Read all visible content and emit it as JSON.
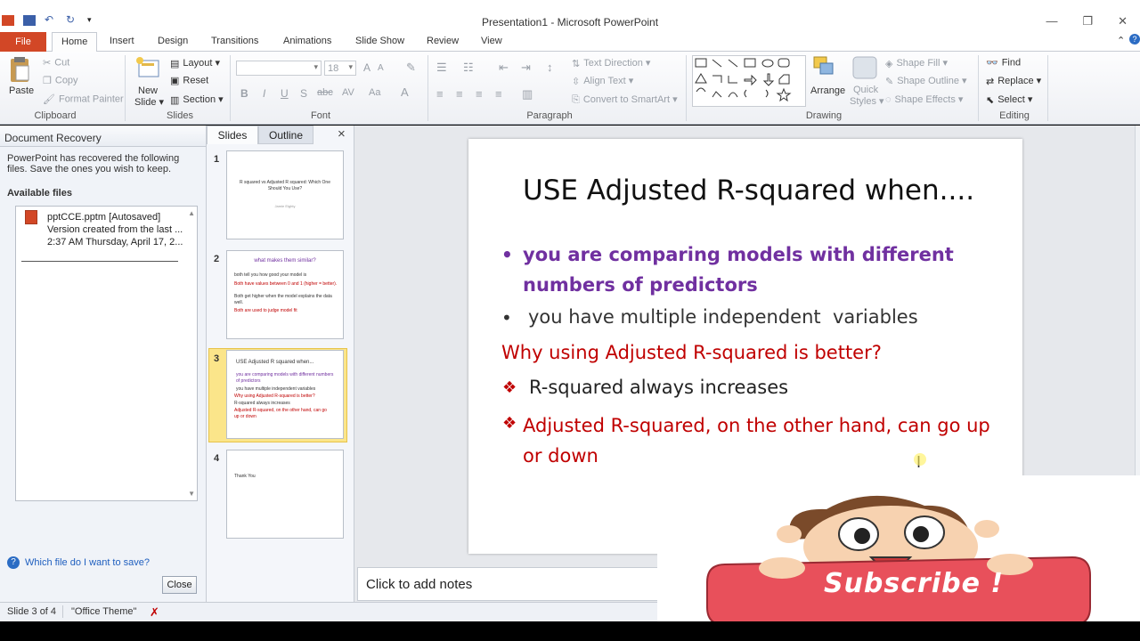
{
  "window": {
    "title": "Presentation1 - Microsoft PowerPoint"
  },
  "tabs": {
    "file": "File",
    "items": [
      "Home",
      "Insert",
      "Design",
      "Transitions",
      "Animations",
      "Slide Show",
      "Review",
      "View"
    ]
  },
  "ribbon": {
    "clipboard": {
      "paste": "Paste",
      "cut": "Cut",
      "copy": "Copy",
      "format_painter": "Format Painter",
      "label": "Clipboard"
    },
    "slides": {
      "new_slide": "New",
      "new_slide2": "Slide",
      "layout": "Layout",
      "reset": "Reset",
      "section": "Section",
      "label": "Slides"
    },
    "font": {
      "size": "18",
      "label": "Font"
    },
    "paragraph": {
      "text_direction": "Text Direction",
      "align_text": "Align Text",
      "convert": "Convert to SmartArt",
      "label": "Paragraph"
    },
    "drawing": {
      "arrange": "Arrange",
      "quick_styles": "Quick",
      "quick_styles2": "Styles",
      "shape_fill": "Shape Fill",
      "shape_outline": "Shape Outline",
      "shape_effects": "Shape Effects",
      "label": "Drawing"
    },
    "editing": {
      "find": "Find",
      "replace": "Replace",
      "select": "Select",
      "label": "Editing"
    }
  },
  "recovery": {
    "header": "Document Recovery",
    "message": "PowerPoint has recovered the following files. Save the ones you wish to keep.",
    "available": "Available files",
    "file_name": "pptCCE.pptm  [Autosaved]",
    "file_line2": "Version created from the last ...",
    "file_line3": "2:37 AM Thursday, April 17, 2...",
    "help_link": "Which file do I want to save?",
    "close": "Close"
  },
  "slide_pane": {
    "tab_slides": "Slides",
    "tab_outline": "Outline",
    "close": "×",
    "thumbs": [
      {
        "num": "1",
        "title": "R squared vs Adjusted R squared: Which One Should You Use?",
        "sub": "Jamie Eighty"
      },
      {
        "num": "2",
        "title": "what makes them similar?",
        "b1": "both tell you how good your model is",
        "b2": "Both have values between 0 and 1 (higher = better).",
        "b3": "Both get higher when the model explains the data well.",
        "b4": "Both are used to judge model fit"
      },
      {
        "num": "3",
        "title": "USE Adjusted R squared when...",
        "b1": "you are comparing models with different numbers of predictors",
        "b2": "you have multiple independent variables",
        "b3": "Why using Adjusted R-squared is better?",
        "b4": "R-squared always increases",
        "b5": "Adjusted R-squared, on the other hand, can go up or down"
      },
      {
        "num": "4",
        "b1": "Thank You"
      }
    ]
  },
  "slide": {
    "title": "USE Adjusted R-squared when....",
    "bullet1": "you are comparing models with different numbers of predictors",
    "bullet2": "you have multiple independent  variables",
    "heading": "Why using Adjusted R-squared is better?",
    "point1": "R-squared always increases",
    "point2": "Adjusted R-squared, on the other hand, can go up or down"
  },
  "notes": {
    "placeholder": "Click to add notes"
  },
  "status": {
    "slide": "Slide 3 of 4",
    "theme": "\"Office Theme\""
  },
  "overlay": {
    "subscribe": "Subscribe !"
  },
  "colors": {
    "purple": "#7030a0",
    "red": "#c00000",
    "file_tab": "#d24726",
    "selected_thumb": "#fbe58a"
  }
}
